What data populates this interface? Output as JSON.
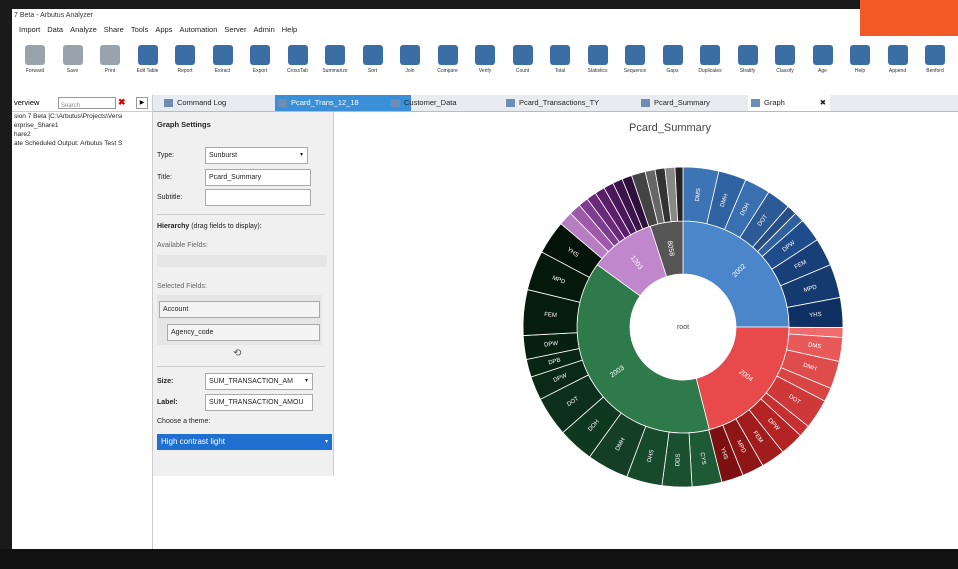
{
  "window": {
    "title": "7 Beta - Arbutus Analyzer"
  },
  "menu": [
    "Import",
    "Data",
    "Analyze",
    "Share",
    "Tools",
    "Apps",
    "Automation",
    "Server",
    "Admin",
    "Help"
  ],
  "toolbar": [
    {
      "label": "Forward",
      "icon": "forward-icon"
    },
    {
      "label": "Save",
      "icon": "save-icon"
    },
    {
      "label": "Print",
      "icon": "print-icon"
    },
    {
      "label": "Edit Table",
      "icon": "edit-table-icon"
    },
    {
      "label": "Report",
      "icon": "report-icon"
    },
    {
      "label": "Extract",
      "icon": "extract-icon"
    },
    {
      "label": "Export",
      "icon": "export-icon"
    },
    {
      "label": "CrossTab",
      "icon": "crosstab-icon"
    },
    {
      "label": "Summarize",
      "icon": "summarize-icon"
    },
    {
      "label": "Sort",
      "icon": "sort-icon"
    },
    {
      "label": "Join",
      "icon": "join-icon"
    },
    {
      "label": "Compare",
      "icon": "compare-icon"
    },
    {
      "label": "Verify",
      "icon": "verify-icon"
    },
    {
      "label": "Count",
      "icon": "count-icon"
    },
    {
      "label": "Total",
      "icon": "total-icon"
    },
    {
      "label": "Statistics",
      "icon": "statistics-icon"
    },
    {
      "label": "Sequence",
      "icon": "sequence-icon"
    },
    {
      "label": "Gaps",
      "icon": "gaps-icon"
    },
    {
      "label": "Duplicates",
      "icon": "duplicates-icon"
    },
    {
      "label": "Stratify",
      "icon": "stratify-icon"
    },
    {
      "label": "Classify",
      "icon": "classify-icon"
    },
    {
      "label": "Age",
      "icon": "age-icon"
    },
    {
      "label": "Help",
      "icon": "help-icon"
    },
    {
      "label": "Append",
      "icon": "append-icon"
    },
    {
      "label": "Benford",
      "icon": "benford-icon"
    }
  ],
  "overview": {
    "label": "verview",
    "search_placeholder": "Search",
    "close_glyph": "✖",
    "arrow_glyph": "▶",
    "tree": [
      "sion 7 Beta [C:\\Arbutus\\Projects\\Versi",
      "erprise_Share1",
      "hare2",
      "ate Scheduled Output: Arbutus Test S"
    ]
  },
  "tabs": [
    {
      "label": "Command Log"
    },
    {
      "label": "Pcard_Trans_12_18"
    },
    {
      "label": "Customer_Data"
    },
    {
      "label": "Pcard_Transactions_TY"
    },
    {
      "label": "Pcard_Summary"
    },
    {
      "label": "Graph"
    }
  ],
  "tab_close_glyph": "✖",
  "settings": {
    "heading": "Graph Settings",
    "type_label": "Type:",
    "type_value": "Sunburst",
    "title_label": "Title:",
    "title_value": "Pcard_Summary",
    "subtitle_label": "Subtitle:",
    "subtitle_value": "",
    "hierarchy_heading": "Hierarchy",
    "hierarchy_hint": "(drag fields to display):",
    "available_fields_label": "Available Fields:",
    "selected_fields_label": "Selected Fields:",
    "selected_fields": [
      "Account",
      "Agency_code"
    ],
    "reset_glyph": "⟲",
    "size_label": "Size:",
    "size_value": "SUM_TRANSACTION_AM",
    "label_label": "Label:",
    "label_value": "SUM_TRANSACTION_AMOU",
    "theme_label": "Choose a theme:",
    "theme_value": "High contrast light",
    "dropdown_glyph": "▾"
  },
  "chart_data": {
    "type": "sunburst",
    "title": "Pcard_Summary",
    "center_label": "root",
    "inner": [
      {
        "name": "2002",
        "value": 25,
        "color": "#4a86c9"
      },
      {
        "name": "2004",
        "value": 21,
        "color": "#e8494b"
      },
      {
        "name": "2003",
        "value": 39,
        "color": "#2f7a4a"
      },
      {
        "name": "1203",
        "value": 10,
        "color": "#c187cc"
      },
      {
        "name": "8058",
        "value": 5,
        "color": "#555555"
      }
    ],
    "outer": [
      {
        "name": "DMS",
        "value": 3.6,
        "color": "#3d74b5"
      },
      {
        "name": "DMH",
        "value": 2.8,
        "color": "#2f62a0"
      },
      {
        "name": "DOH",
        "value": 2.6,
        "color": "#3a6fb0"
      },
      {
        "name": "DOT",
        "value": 2.4,
        "color": "#2c5a95"
      },
      {
        "name": "",
        "value": 1.0,
        "color": "#274f86"
      },
      {
        "name": "",
        "value": 1.0,
        "color": "#30609e"
      },
      {
        "name": "DPW",
        "value": 2.4,
        "color": "#1f4d8c"
      },
      {
        "name": "FEM",
        "value": 2.8,
        "color": "#183f78"
      },
      {
        "name": "MPD",
        "value": 3.4,
        "color": "#143a70"
      },
      {
        "name": "YHS",
        "value": 3.0,
        "color": "#0f3062"
      },
      {
        "name": "",
        "value": 1.0,
        "color": "#f06b6b"
      },
      {
        "name": "DMS",
        "value": 2.4,
        "color": "#e85a5a"
      },
      {
        "name": "DMH",
        "value": 2.8,
        "color": "#de4c4c"
      },
      {
        "name": "",
        "value": 1.4,
        "color": "#d94444"
      },
      {
        "name": "DOT",
        "value": 3.0,
        "color": "#cf3838"
      },
      {
        "name": "",
        "value": 1.2,
        "color": "#c53030"
      },
      {
        "name": "DPW",
        "value": 2.4,
        "color": "#b52424"
      },
      {
        "name": "FEM",
        "value": 2.4,
        "color": "#a11d1d"
      },
      {
        "name": "MPD",
        "value": 2.2,
        "color": "#8f1616"
      },
      {
        "name": "YHS",
        "value": 2.2,
        "color": "#7c1010"
      },
      {
        "name": "CYS",
        "value": 3.0,
        "color": "#1f5a36"
      },
      {
        "name": "DDS",
        "value": 3.0,
        "color": "#1a5030"
      },
      {
        "name": "DHS",
        "value": 3.6,
        "color": "#17492b"
      },
      {
        "name": "DMH",
        "value": 4.2,
        "color": "#143f26"
      },
      {
        "name": "DOH",
        "value": 3.6,
        "color": "#0f3820"
      },
      {
        "name": "DOT",
        "value": 4.0,
        "color": "#0c301b"
      },
      {
        "name": "DPW",
        "value": 2.4,
        "color": "#0a2a17"
      },
      {
        "name": "DPB",
        "value": 1.8,
        "color": "#092513"
      },
      {
        "name": "DPW",
        "value": 2.4,
        "color": "#072010"
      },
      {
        "name": "FEM",
        "value": 4.6,
        "color": "#061c0e"
      },
      {
        "name": "MPD",
        "value": 4.0,
        "color": "#05180c"
      },
      {
        "name": "YHS",
        "value": 3.4,
        "color": "#04140a"
      },
      {
        "name": "",
        "value": 1.4,
        "color": "#b67ec1"
      },
      {
        "name": "",
        "value": 1.2,
        "color": "#9c5aa8"
      },
      {
        "name": "",
        "value": 1.0,
        "color": "#7e3c8e"
      },
      {
        "name": "",
        "value": 1.0,
        "color": "#6a2a7a"
      },
      {
        "name": "",
        "value": 1.0,
        "color": "#5a1e6a"
      },
      {
        "name": "",
        "value": 1.0,
        "color": "#48185a"
      },
      {
        "name": "",
        "value": 1.0,
        "color": "#3a144a"
      },
      {
        "name": "",
        "value": 1.0,
        "color": "#2e103c"
      },
      {
        "name": "",
        "value": 1.4,
        "color": "#444444"
      },
      {
        "name": "",
        "value": 1.0,
        "color": "#666666"
      },
      {
        "name": "",
        "value": 1.0,
        "color": "#333333"
      },
      {
        "name": "",
        "value": 1.0,
        "color": "#888888"
      },
      {
        "name": "",
        "value": 0.8,
        "color": "#222222"
      }
    ]
  }
}
